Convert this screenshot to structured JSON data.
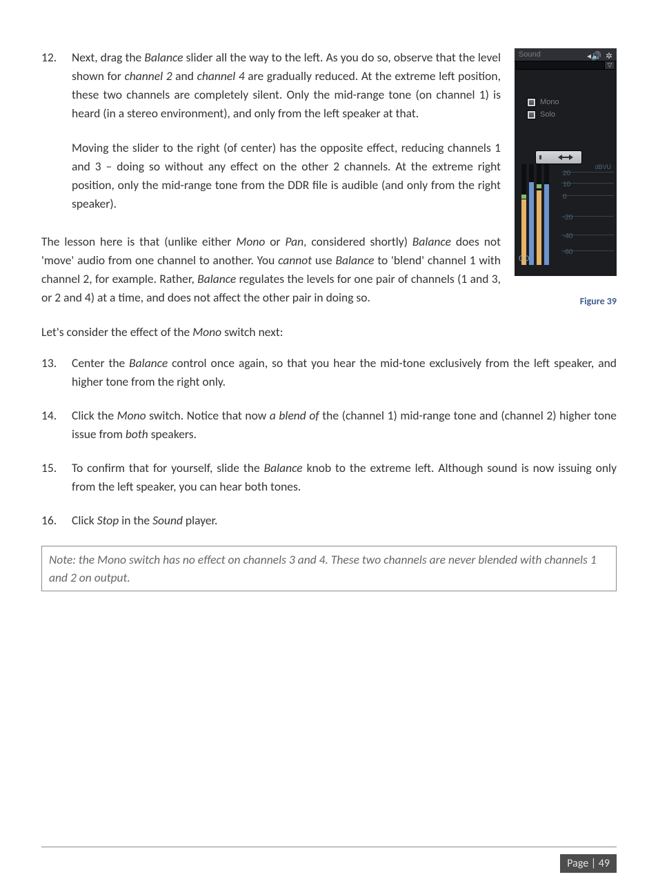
{
  "figure": {
    "panel_title": "Sound",
    "checks": {
      "mono": "Mono",
      "solo": "Solo"
    },
    "dropdown_glyph": "▽",
    "scale_unit": "dBVU",
    "scale_ticks": [
      {
        "label": "20",
        "pct": 8
      },
      {
        "label": "10",
        "pct": 20
      },
      {
        "label": "0",
        "pct": 33
      },
      {
        "label": "-20",
        "pct": 55
      },
      {
        "label": "-40",
        "pct": 75
      },
      {
        "label": "-60",
        "pct": 92
      }
    ],
    "bars": [
      {
        "fill_pct": 65,
        "fill_color": "#e6b466",
        "peak_pct": 30,
        "peak_color": "#7fbf6a"
      },
      {
        "fill_pct": 82,
        "fill_color": "#6c95cf",
        "peak_pct": 0,
        "peak_color": ""
      },
      {
        "fill_pct": 74,
        "fill_color": "#e6b466",
        "peak_pct": 20,
        "peak_color": "#7fbf6a"
      },
      {
        "fill_pct": 80,
        "fill_color": "#6c95cf",
        "peak_pct": 0,
        "peak_color": ""
      }
    ],
    "readout": "0.0",
    "caption": "Figure 39"
  },
  "list": {
    "item12": {
      "num": "12.",
      "text1": "Next, drag the ",
      "em1": "Balance",
      "text2": " slider all the way to the left.  As you do so, observe that the level shown for ",
      "em2": "channel 2",
      "text3": " and ",
      "em3": "channel 4",
      "text4": " are gradually reduced.  At the extreme left position, these two channels are completely silent.  Only the mid-range tone (on channel 1) is heard (in a stereo environment), and only from the left speaker at that."
    },
    "item12b": "Moving the slider to the right (of center) has the opposite effect, reducing channels 1 and 3 – doing so without any effect on the other 2 channels.  At the extreme right position, only the mid-range tone from the DDR file is audible (and only from the right speaker)."
  },
  "lesson": {
    "t1": "The lesson here is that (unlike either ",
    "e1": "Mono",
    "t2": " or ",
    "e2": "Pan",
    "t3": ", considered shortly) ",
    "e3": "Balance",
    "t4": " does not 'move' audio from one channel to another.  You ",
    "e4": "cannot",
    "t5": " use ",
    "e5": "Balance",
    "t6": " to 'blend' channel 1 with channel 2, for example.  Rather, ",
    "e6": "Balance",
    "t7": " regulates the levels for one pair of channels (1 and 3, or 2 and 4) at a time, and does not affect the other pair in doing so."
  },
  "mono_intro": {
    "t1": "Let's consider the effect of the ",
    "e1": "Mono",
    "t2": " switch next:"
  },
  "list2": {
    "item13": {
      "num": "13.",
      "t1": "Center the ",
      "e1": "Balance",
      "t2": " control once again, so that you hear the mid-tone exclusively from the left speaker, and higher tone from the right only."
    },
    "item14": {
      "num": "14.",
      "t1": "Click the ",
      "e1": "Mono",
      "t2": " switch.  Notice that now ",
      "e2": "a blend of",
      "t3": " the (channel 1) mid-range tone and (channel 2) higher tone issue from ",
      "e3": "both",
      "t4": " speakers."
    },
    "item15": {
      "num": "15.",
      "t1": "To confirm that for yourself, slide the ",
      "e1": "Balance",
      "t2": " knob to the extreme left.  Although sound is now issuing only from the left speaker, you can hear both tones."
    },
    "item16": {
      "num": "16.",
      "t1": "Click ",
      "e1": "Stop",
      "t2": " in the ",
      "e2": "Sound",
      "t3": " player."
    }
  },
  "note": "Note: the Mono switch has no effect on channels 3 and 4.  These two channels are never blended with channels 1 and 2 on output.",
  "footer": {
    "page_label": "Page | 49"
  }
}
